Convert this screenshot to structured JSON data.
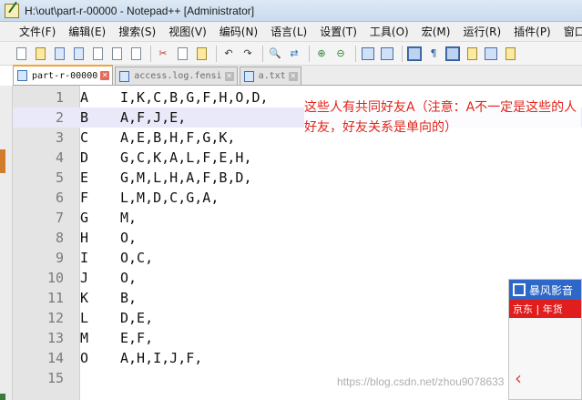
{
  "window": {
    "title": "H:\\out\\part-r-00000 - Notepad++ [Administrator]"
  },
  "menu": [
    "文件(F)",
    "编辑(E)",
    "搜索(S)",
    "视图(V)",
    "编码(N)",
    "语言(L)",
    "设置(T)",
    "工具(O)",
    "宏(M)",
    "运行(R)",
    "插件(P)",
    "窗口(W)"
  ],
  "toolbar": {
    "icons": [
      "new-file-icon",
      "open-file-icon",
      "save-icon",
      "save-all-icon",
      "close-icon",
      "close-all-icon",
      "print-icon",
      "cut-icon",
      "copy-icon",
      "paste-icon",
      "undo-icon",
      "redo-icon",
      "find-icon",
      "replace-icon",
      "zoom-in-icon",
      "zoom-out-icon",
      "sync-vertical-icon",
      "sync-horizontal-icon",
      "word-wrap-icon",
      "show-all-chars-icon",
      "indent-guide-icon",
      "doc-map-icon",
      "function-list-icon",
      "folder-as-workspace-icon"
    ]
  },
  "tabs": [
    {
      "label": "part-r-00000",
      "active": true
    },
    {
      "label": "access.log.fensi",
      "active": false
    },
    {
      "label": "a.txt",
      "active": false
    }
  ],
  "editor": {
    "current_line": 2,
    "lines": [
      {
        "num": "1",
        "a": "A",
        "b": "I,K,C,B,G,F,H,O,D,"
      },
      {
        "num": "2",
        "a": "B",
        "b": "A,F,J,E,"
      },
      {
        "num": "3",
        "a": "C",
        "b": "A,E,B,H,F,G,K,"
      },
      {
        "num": "4",
        "a": "D",
        "b": "G,C,K,A,L,F,E,H,"
      },
      {
        "num": "5",
        "a": "E",
        "b": "G,M,L,H,A,F,B,D,"
      },
      {
        "num": "6",
        "a": "F",
        "b": "L,M,D,C,G,A,"
      },
      {
        "num": "7",
        "a": "G",
        "b": "M,"
      },
      {
        "num": "8",
        "a": "H",
        "b": "O,"
      },
      {
        "num": "9",
        "a": "I",
        "b": "O,C,"
      },
      {
        "num": "10",
        "a": "J",
        "b": "O,"
      },
      {
        "num": "11",
        "a": "K",
        "b": "B,"
      },
      {
        "num": "12",
        "a": "L",
        "b": "D,E,"
      },
      {
        "num": "13",
        "a": "M",
        "b": "E,F,"
      },
      {
        "num": "14",
        "a": "O",
        "b": "A,H,I,J,F,"
      },
      {
        "num": "15",
        "a": "",
        "b": ""
      }
    ]
  },
  "annotation": {
    "text": "这些人有共同好友A（注意：A不一定是这些的人好友，好友关系是单向的）",
    "color": "#e0241a"
  },
  "popup": {
    "title": "暴风影音",
    "band": "京东 | 年货"
  },
  "watermark": {
    "text": "https://blog.csdn.net/zhou9078633"
  },
  "colors": {
    "tab_accent": "#f2a33a",
    "current_line_bg": "#e9e9f9",
    "gutter_bg": "#e4e4e4",
    "popup_blue": "#2d67c8",
    "popup_red": "#e01e1e"
  }
}
